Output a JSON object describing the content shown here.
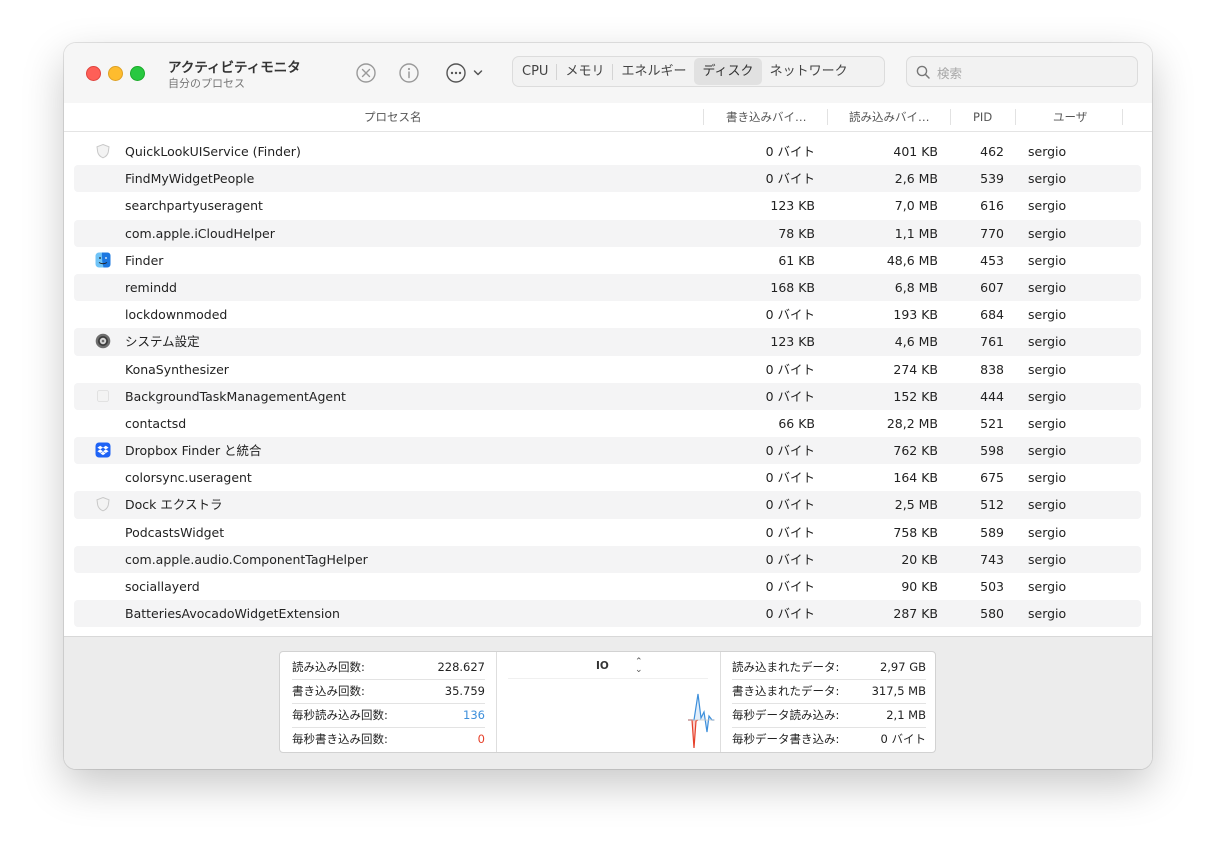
{
  "window": {
    "title": "アクティビティモニタ",
    "subtitle": "自分のプロセス"
  },
  "toolbar": {
    "tabs": [
      {
        "label": "CPU",
        "active": false
      },
      {
        "label": "メモリ",
        "active": false
      },
      {
        "label": "エネルギー",
        "active": false
      },
      {
        "label": "ディスク",
        "active": true
      },
      {
        "label": "ネットワーク",
        "active": false
      }
    ],
    "search_placeholder": "検索",
    "icons": [
      "stop-process-icon",
      "info-icon",
      "more-actions-icon",
      "chevron-down-icon",
      "search-icon"
    ]
  },
  "columns": {
    "name": "プロセス名",
    "bytes_written": "書き込みバイ…",
    "bytes_read": "読み込みバイ…",
    "pid": "PID",
    "user": "ユーザ"
  },
  "processes": [
    {
      "name": "QuickLookUIService (Finder)",
      "written": "0 バイト",
      "read": "401 KB",
      "pid": "462",
      "user": "sergio",
      "icon": "shield-icon"
    },
    {
      "name": "FindMyWidgetPeople",
      "written": "0 バイト",
      "read": "2,6 MB",
      "pid": "539",
      "user": "sergio",
      "icon": ""
    },
    {
      "name": "searchpartyuseragent",
      "written": "123 KB",
      "read": "7,0 MB",
      "pid": "616",
      "user": "sergio",
      "icon": ""
    },
    {
      "name": "com.apple.iCloudHelper",
      "written": "78 KB",
      "read": "1,1 MB",
      "pid": "770",
      "user": "sergio",
      "icon": ""
    },
    {
      "name": "Finder",
      "written": "61 KB",
      "read": "48,6 MB",
      "pid": "453",
      "user": "sergio",
      "icon": "finder-icon"
    },
    {
      "name": "remindd",
      "written": "168 KB",
      "read": "6,8 MB",
      "pid": "607",
      "user": "sergio",
      "icon": ""
    },
    {
      "name": "lockdownmoded",
      "written": "0 バイト",
      "read": "193 KB",
      "pid": "684",
      "user": "sergio",
      "icon": ""
    },
    {
      "name": "システム設定",
      "written": "123 KB",
      "read": "4,6 MB",
      "pid": "761",
      "user": "sergio",
      "icon": "system-settings-icon"
    },
    {
      "name": "KonaSynthesizer",
      "written": "0 バイト",
      "read": "274 KB",
      "pid": "838",
      "user": "sergio",
      "icon": ""
    },
    {
      "name": "BackgroundTaskManagementAgent",
      "written": "0 バイト",
      "read": "152 KB",
      "pid": "444",
      "user": "sergio",
      "icon": "app-placeholder-icon"
    },
    {
      "name": "contactsd",
      "written": "66 KB",
      "read": "28,2 MB",
      "pid": "521",
      "user": "sergio",
      "icon": ""
    },
    {
      "name": "Dropbox Finder と統合",
      "written": "0 バイト",
      "read": "762 KB",
      "pid": "598",
      "user": "sergio",
      "icon": "dropbox-icon"
    },
    {
      "name": "colorsync.useragent",
      "written": "0 バイト",
      "read": "164 KB",
      "pid": "675",
      "user": "sergio",
      "icon": ""
    },
    {
      "name": "Dock エクストラ",
      "written": "0 バイト",
      "read": "2,5 MB",
      "pid": "512",
      "user": "sergio",
      "icon": "shield-icon"
    },
    {
      "name": "PodcastsWidget",
      "written": "0 バイト",
      "read": "758 KB",
      "pid": "589",
      "user": "sergio",
      "icon": ""
    },
    {
      "name": "com.apple.audio.ComponentTagHelper",
      "written": "0 バイト",
      "read": "20 KB",
      "pid": "743",
      "user": "sergio",
      "icon": ""
    },
    {
      "name": "sociallayerd",
      "written": "0 バイト",
      "read": "90 KB",
      "pid": "503",
      "user": "sergio",
      "icon": ""
    },
    {
      "name": "BatteriesAvocadoWidgetExtension",
      "written": "0 バイト",
      "read": "287 KB",
      "pid": "580",
      "user": "sergio",
      "icon": ""
    }
  ],
  "stats_left": [
    {
      "label": "読み込み回数:",
      "value": "228.627",
      "color": "#222222"
    },
    {
      "label": "書き込み回数:",
      "value": "35.759",
      "color": "#222222"
    },
    {
      "label": "毎秒読み込み回数:",
      "value": "136",
      "color": "#3d8fdb"
    },
    {
      "label": "毎秒書き込み回数:",
      "value": "0",
      "color": "#e6402a"
    }
  ],
  "graph": {
    "mode_label": "IO",
    "read_color": "#3d8fdb",
    "write_color": "#e6402a"
  },
  "stats_right": [
    {
      "label": "読み込まれたデータ:",
      "value": "2,97 GB"
    },
    {
      "label": "書き込まれたデータ:",
      "value": "317,5 MB"
    },
    {
      "label": "毎秒データ読み込み:",
      "value": "2,1 MB"
    },
    {
      "label": "毎秒データ書き込み:",
      "value": "0 バイト"
    }
  ]
}
